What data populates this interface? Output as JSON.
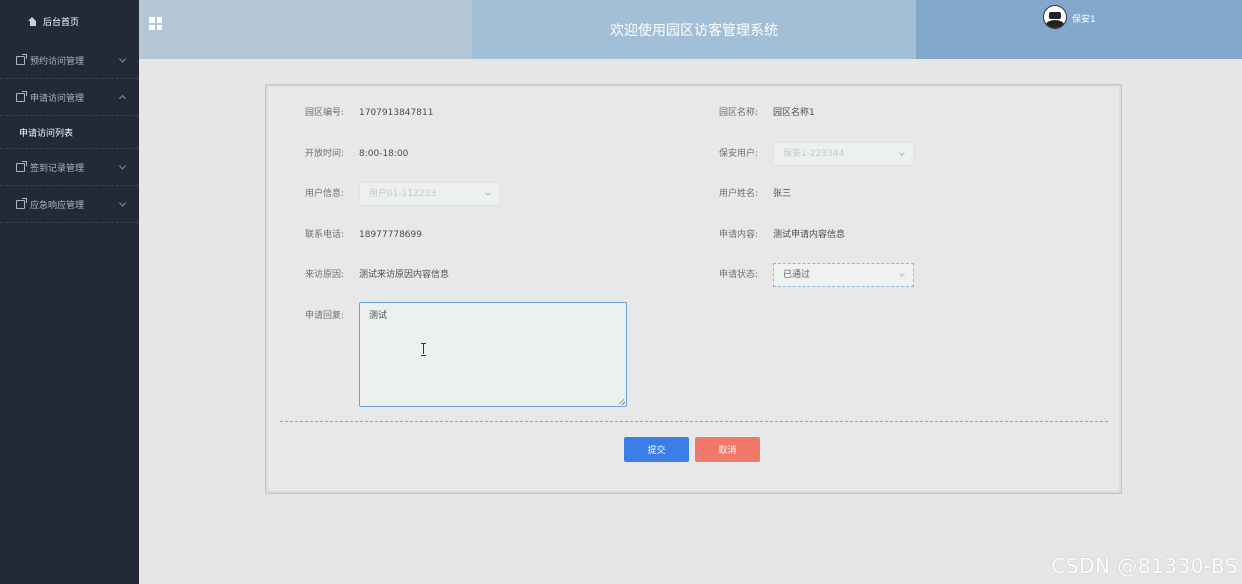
{
  "sidebar": {
    "home_label": "后台首页",
    "items": [
      {
        "label": "预约访问管理"
      },
      {
        "label": "申请访问管理"
      },
      {
        "label": "签到记录管理"
      },
      {
        "label": "应急响应管理"
      }
    ],
    "sub_item": "申请访问列表"
  },
  "header": {
    "title": "欢迎使用园区访客管理系统",
    "user_name": "保安1"
  },
  "form": {
    "park_no_label": "园区编号:",
    "park_no_value": "1707913847811",
    "park_name_label": "园区名称:",
    "park_name_value": "园区名称1",
    "open_time_label": "开放时间:",
    "open_time_value": "8:00-18:00",
    "guard_label": "保安用户:",
    "guard_value": "保安1-223344",
    "user_info_label": "用户信息:",
    "user_info_value": "用户01-112233",
    "user_name_label": "用户姓名:",
    "user_name_value": "张三",
    "phone_label": "联系电话:",
    "phone_value": "18977778699",
    "apply_content_label": "申请内容:",
    "apply_content_value": "测试申请内容信息",
    "visit_reason_label": "来访原因:",
    "visit_reason_value": "测试来访原因内容信息",
    "status_label": "申请状态:",
    "status_value": "已通过",
    "reply_label": "申请回复:",
    "reply_value": "测试"
  },
  "buttons": {
    "submit": "提交",
    "cancel": "取消"
  },
  "watermark": "CSDN @81330-BS"
}
